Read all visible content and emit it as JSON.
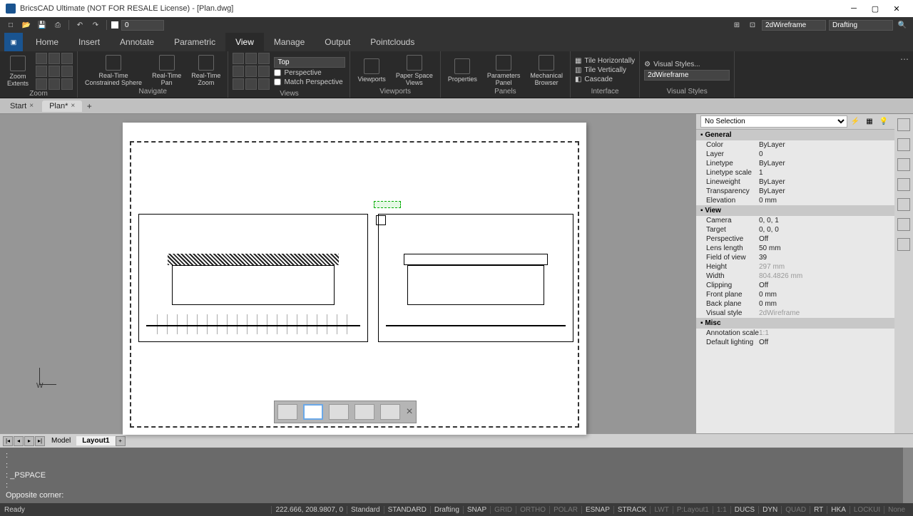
{
  "title": "BricsCAD Ultimate (NOT FOR RESALE License) - [Plan.dwg]",
  "qat": {
    "layer": "0",
    "render_mode": "2dWireframe",
    "workspace": "Drafting"
  },
  "tabs": [
    "Home",
    "Insert",
    "Annotate",
    "Parametric",
    "View",
    "Manage",
    "Output",
    "Pointclouds"
  ],
  "active_tab": "View",
  "ribbon": {
    "zoom": {
      "label": "Zoom",
      "extents": "Zoom\nExtents"
    },
    "navigate": {
      "label": "Navigate",
      "items": [
        "Real-Time\nConstrained Sphere",
        "Real-Time\nPan",
        "Real-Time\nZoom"
      ]
    },
    "views": {
      "label": "Views",
      "view_sel": "Top",
      "perspective": "Perspective",
      "match": "Match Perspective"
    },
    "viewports": {
      "label": "Viewports",
      "items": [
        "Viewports",
        "Paper Space\nViews"
      ]
    },
    "panels": {
      "label": "Panels",
      "items": [
        "Properties",
        "Parameters\nPanel",
        "Mechanical\nBrowser"
      ]
    },
    "interface": {
      "label": "Interface",
      "tile_h": "Tile Horizontally",
      "tile_v": "Tile Vertically",
      "cascade": "Cascade"
    },
    "visual": {
      "label": "Visual Styles",
      "link": "Visual Styles...",
      "sel": "2dWireframe"
    }
  },
  "doctabs": {
    "start": "Start",
    "plan": "Plan*"
  },
  "properties": {
    "selection": "No Selection",
    "general": {
      "Color": "ByLayer",
      "Layer": "0",
      "Linetype": "ByLayer",
      "Linetype scale": "1",
      "Lineweight": "ByLayer",
      "Transparency": "ByLayer",
      "Elevation": "0 mm"
    },
    "view": {
      "Camera": "0, 0, 1",
      "Target": "0, 0, 0",
      "Perspective": "Off",
      "Lens length": "50 mm",
      "Field of view": "39",
      "Height": "297 mm",
      "Width": "804.4826 mm",
      "Clipping": "Off",
      "Front plane": "0 mm",
      "Back plane": "0 mm",
      "Visual style": "2dWireframe"
    },
    "misc": {
      "Annotation scale": "1:1",
      "Default lighting": "Off"
    }
  },
  "layouttabs": {
    "model": "Model",
    "layout": "Layout1"
  },
  "cmd": {
    "l1": ":",
    "l2": ":",
    "l3": ": _PSPACE",
    "l4": ":",
    "prompt": "Opposite corner:"
  },
  "status": {
    "ready": "Ready",
    "coords": "222.666, 208.9807, 0",
    "anno": "Standard",
    "text": "STANDARD",
    "ws": "Drafting",
    "toggles": [
      "SNAP",
      "GRID",
      "ORTHO",
      "POLAR",
      "ESNAP",
      "STRACK",
      "LWT",
      "P:Layout1",
      "1:1",
      "DUCS",
      "DYN",
      "QUAD",
      "RT",
      "HKA",
      "LOCKUI",
      "None"
    ]
  },
  "ucs_label": "W"
}
